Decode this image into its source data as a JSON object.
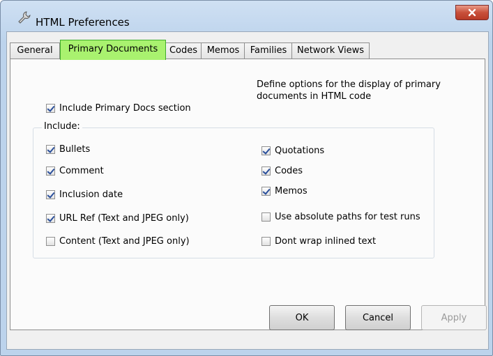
{
  "window": {
    "title": "HTML Preferences",
    "title_icon": "wrench-icon",
    "close_label": "x"
  },
  "tabs": [
    {
      "label": "General",
      "active": false
    },
    {
      "label": "Primary Documents",
      "active": true
    },
    {
      "label": "Codes",
      "active": false
    },
    {
      "label": "Memos",
      "active": false
    },
    {
      "label": "Families",
      "active": false
    },
    {
      "label": "Network Views",
      "active": false
    }
  ],
  "description": "Define options for the display of primary documents in HTML code",
  "include_section": {
    "label": "Include Primary Docs section",
    "checked": true
  },
  "group_label": "Include:",
  "left_options": [
    {
      "label": "Bullets",
      "checked": true
    },
    {
      "label": "Comment",
      "checked": true
    },
    {
      "label": "Inclusion date",
      "checked": true
    },
    {
      "label": "URL Ref (Text and JPEG only)",
      "checked": true
    },
    {
      "label": "Content  (Text and JPEG only)",
      "checked": false
    }
  ],
  "right_options": [
    {
      "label": "Quotations",
      "checked": true
    },
    {
      "label": "Codes",
      "checked": true
    },
    {
      "label": "Memos",
      "checked": true
    },
    {
      "label": "Use absolute paths for test runs",
      "checked": false
    },
    {
      "label": "Dont wrap inlined text",
      "checked": false
    }
  ],
  "buttons": {
    "ok": "OK",
    "cancel": "Cancel",
    "apply": "Apply"
  },
  "colors": {
    "active_tab": "#a9f26f",
    "close_button": "#c8503b",
    "checkmark": "#2a4f9b"
  }
}
